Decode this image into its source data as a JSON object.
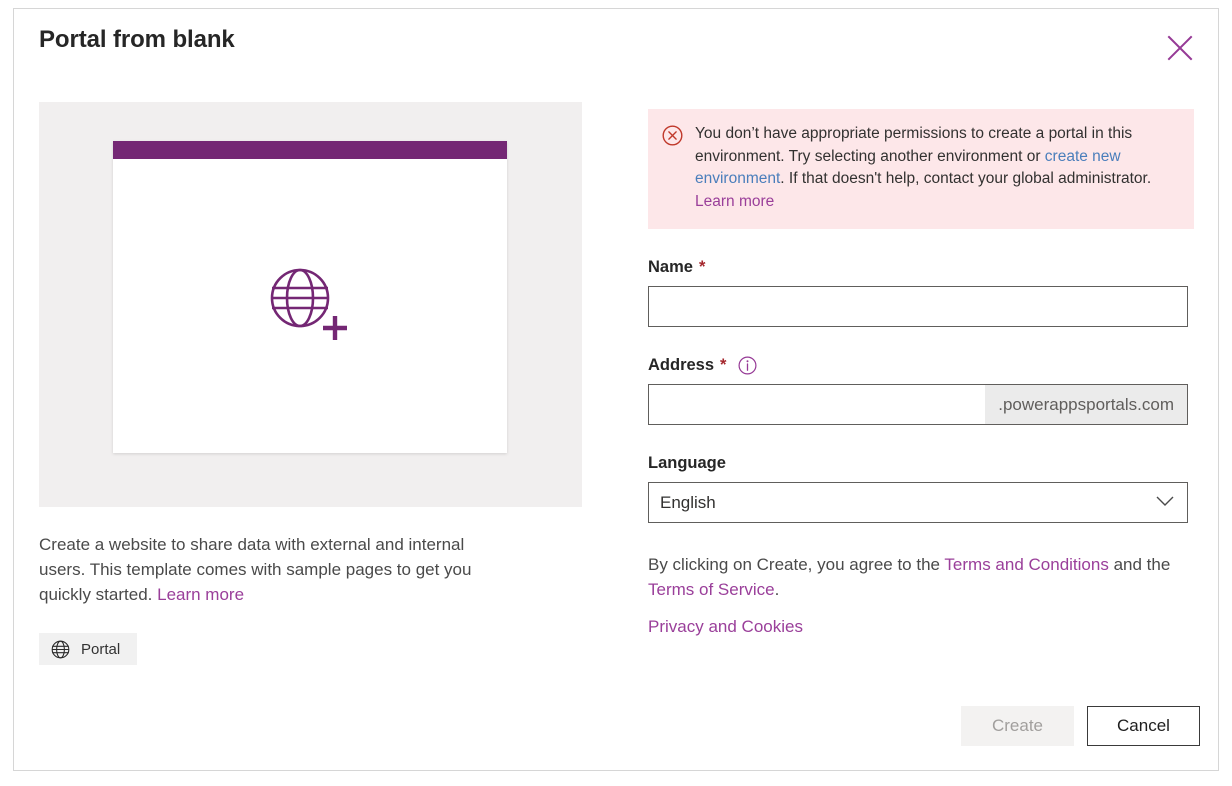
{
  "dialog": {
    "title": "Portal from blank",
    "close_icon": "close-icon"
  },
  "preview": {
    "icon": "globe-plus-icon",
    "header_bar_color": "#742774"
  },
  "template": {
    "description_part1": "Create a website to share data with external and internal users. This template comes with sample pages to get you quickly started. ",
    "learn_more_label": "Learn more",
    "tag_icon": "globe-icon",
    "tag_label": "Portal"
  },
  "error": {
    "icon": "error-circle-x-icon",
    "text_part1": "You don’t have appropriate permissions to create a portal in this environment. Try selecting another environment or ",
    "link_label": "create new environment",
    "text_part2": ". If that doesn't help, contact your global administrator. ",
    "learn_more_label": "Learn more",
    "background_color": "#fde7e9",
    "link_color": "#4a7ebb"
  },
  "form": {
    "name": {
      "label": "Name",
      "required_marker": "*",
      "value": "",
      "placeholder": ""
    },
    "address": {
      "label": "Address",
      "required_marker": "*",
      "info_icon": "info-icon",
      "value": "",
      "placeholder": "",
      "suffix": ".powerappsportals.com"
    },
    "language": {
      "label": "Language",
      "selected": "English",
      "chevron_icon": "chevron-down-icon"
    }
  },
  "legal": {
    "terms_prefix": "By clicking on Create, you agree to the ",
    "terms_and_conditions_label": "Terms and Conditions",
    "terms_middle": " and the ",
    "terms_of_service_label": "Terms of Service",
    "terms_suffix": ".",
    "privacy_label": "Privacy and Cookies"
  },
  "footer": {
    "create_label": "Create",
    "cancel_label": "Cancel"
  },
  "theme": {
    "accent_purple": "#742774",
    "link_purple": "#9a3f9a",
    "required_red": "#a4262c",
    "error_red": "#c0392b"
  }
}
